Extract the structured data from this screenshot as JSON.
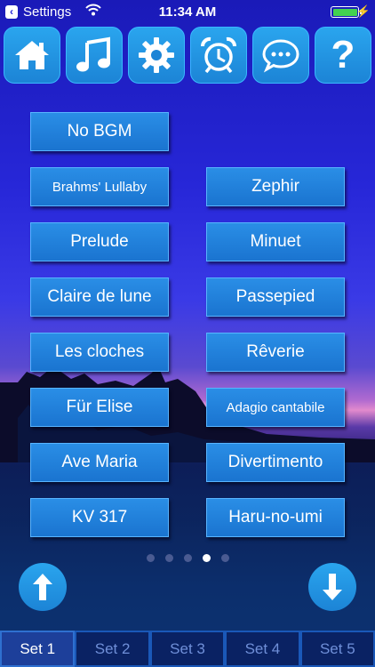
{
  "status_bar": {
    "back_label": "Settings",
    "time": "11:34 AM",
    "battery_level": 1.0,
    "battery_color": "#43d14f"
  },
  "toolbar": {
    "buttons": [
      {
        "icon": "home-icon"
      },
      {
        "icon": "music-note-icon"
      },
      {
        "icon": "gear-icon"
      },
      {
        "icon": "alarm-clock-icon"
      },
      {
        "icon": "chat-bubble-icon"
      },
      {
        "icon": "help-question-icon",
        "label": "?"
      }
    ]
  },
  "songs": {
    "left": [
      "No BGM",
      "Brahms' Lullaby",
      "Prelude",
      "Claire de lune",
      "Les cloches",
      "Für Elise",
      "Ave Maria",
      "KV 317"
    ],
    "right": [
      "Zephir",
      "Minuet",
      "Passepied",
      "Rêverie",
      "Adagio cantabile",
      "Divertimento",
      "Haru-no-umi"
    ]
  },
  "pager": {
    "total": 5,
    "active_index": 3
  },
  "nav": {
    "up_icon": "arrow-up-icon",
    "down_icon": "arrow-down-icon"
  },
  "tabs": [
    {
      "label": "Set 1",
      "active": true
    },
    {
      "label": "Set 2",
      "active": false
    },
    {
      "label": "Set 3",
      "active": false
    },
    {
      "label": "Set 4",
      "active": false
    },
    {
      "label": "Set 5",
      "active": false
    }
  ],
  "colors": {
    "button_blue": "#1c84d6",
    "tab_active": "#1d3f9a",
    "tab_inactive_text": "#6f8fd8"
  }
}
